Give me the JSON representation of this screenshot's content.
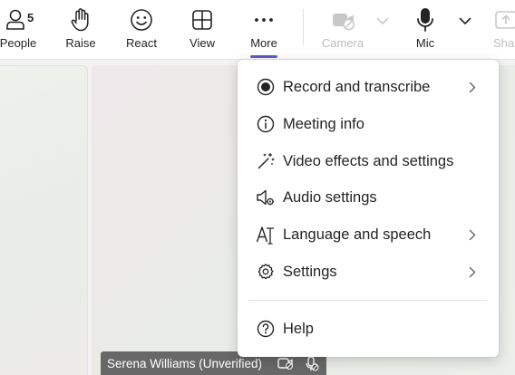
{
  "toolbar": {
    "people": {
      "label": "People",
      "count": "5",
      "icon": "people-icon"
    },
    "raise": {
      "label": "Raise",
      "icon": "raise-hand-icon"
    },
    "react": {
      "label": "React",
      "icon": "smiley-icon"
    },
    "view": {
      "label": "View",
      "icon": "grid-view-icon"
    },
    "more": {
      "label": "More",
      "icon": "more-horizontal-icon",
      "active": true
    },
    "camera": {
      "label": "Camera",
      "icon": "camera-off-icon",
      "disabled": true
    },
    "mic": {
      "label": "Mic",
      "icon": "mic-icon"
    },
    "share": {
      "label": "Shar",
      "icon": "share-icon",
      "disabled": true
    },
    "accent_color": "#5b5fc7"
  },
  "more_menu": {
    "items": [
      {
        "label": "Record and transcribe",
        "icon": "record-icon",
        "has_submenu": true
      },
      {
        "label": "Meeting info",
        "icon": "info-icon",
        "has_submenu": false
      },
      {
        "label": "Video effects and settings",
        "icon": "magic-wand-icon",
        "has_submenu": false
      },
      {
        "label": "Audio settings",
        "icon": "speaker-settings-icon",
        "has_submenu": false
      },
      {
        "label": "Language and speech",
        "icon": "language-icon",
        "has_submenu": true
      },
      {
        "label": "Settings",
        "icon": "gear-icon",
        "has_submenu": true
      },
      {
        "label": "Help",
        "icon": "help-icon",
        "has_submenu": false
      }
    ]
  },
  "stage": {
    "participant_name": "Serena Williams (Unverified)",
    "participant_icons": [
      "camera-off-icon",
      "mic-off-icon"
    ]
  }
}
